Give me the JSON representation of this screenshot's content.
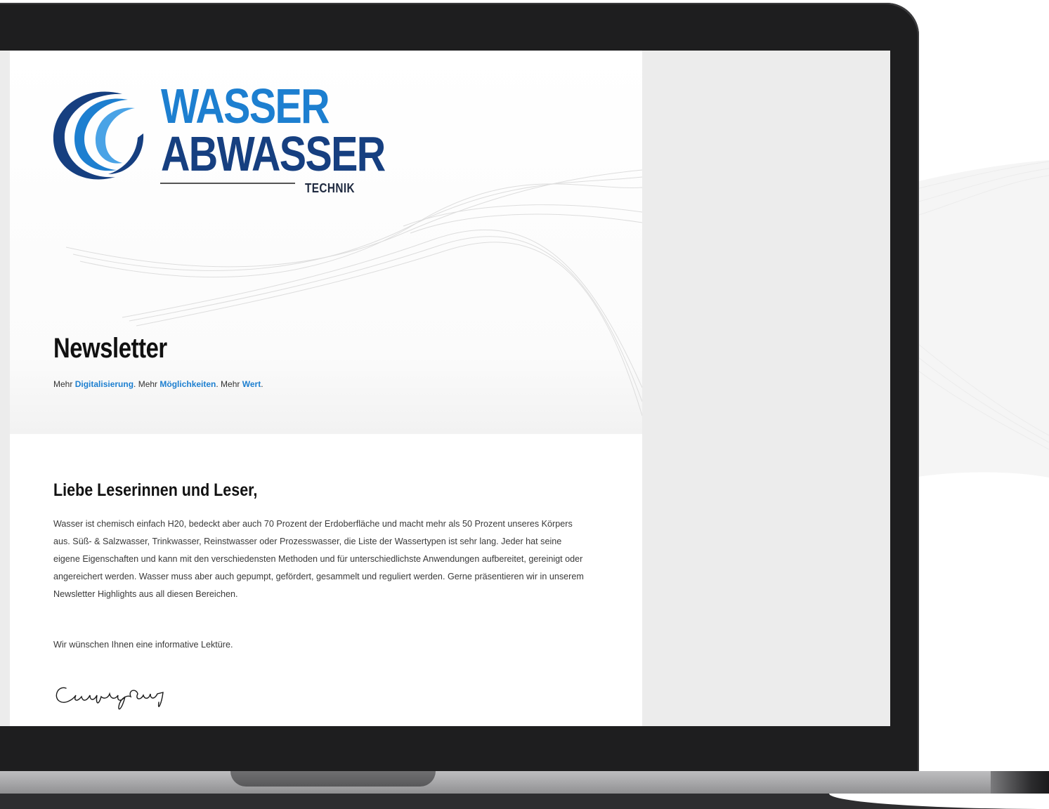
{
  "logo": {
    "line1": "WASSER",
    "line2": "ABWASSER",
    "sub": "TECHNIK"
  },
  "newsletter": {
    "title": "Newsletter",
    "tagline": {
      "p1": "Mehr ",
      "h1": "Digitalisierung",
      "p2": ". Mehr ",
      "h2": "Möglichkeiten",
      "p3": ". Mehr ",
      "h3": "Wert",
      "p4": "."
    }
  },
  "letter": {
    "greeting": "Liebe Leserinnen und Leser,",
    "body": "Wasser ist chemisch einfach H20, bedeckt aber auch 70 Prozent der Erdoberfläche und macht mehr als 50 Prozent unseres Körpers aus. Süß- & Salzwasser, Trinkwasser, Reinstwasser oder Prozesswasser, die Liste der Wassertypen ist sehr lang. Jeder hat seine eigene Eigenschaften und kann mit den verschiedensten Methoden und für unterschiedlichste Anwendungen aufbereitet, gereinigt oder angereichert werden. Wasser muss aber auch gepumpt, gefördert, gesammelt und reguliert werden. Gerne präsentieren wir in unserem Newsletter Highlights aus all diesen Bereichen.",
    "closing": "Wir wünschen Ihnen eine informative Lektüre."
  },
  "colors": {
    "brand_light": "#1d7fd0",
    "brand_dark": "#163f80",
    "bezel": "#1e1e1f"
  }
}
